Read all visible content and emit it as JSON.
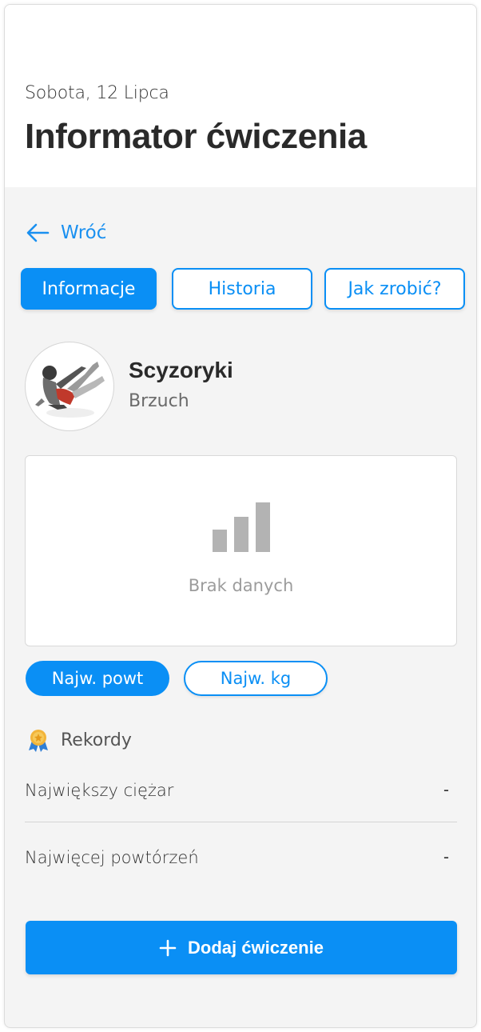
{
  "header": {
    "date": "Sobota, 12 Lipca",
    "title": "Informator ćwiczenia"
  },
  "nav": {
    "back_label": "Wróć"
  },
  "tabs": [
    {
      "label": "Informacje",
      "active": true
    },
    {
      "label": "Historia",
      "active": false
    },
    {
      "label": "Jak zrobić?",
      "active": false
    }
  ],
  "exercise": {
    "name": "Scyzoryki",
    "muscle_group": "Brzuch"
  },
  "chart": {
    "empty_text": "Brak danych"
  },
  "chart_toggle": [
    {
      "label": "Najw. powt",
      "active": true
    },
    {
      "label": "Najw. kg",
      "active": false
    }
  ],
  "records": {
    "title": "Rekordy",
    "rows": [
      {
        "label": "Największy ciężar",
        "value": "-"
      },
      {
        "label": "Najwięcej powtórzeń",
        "value": "-"
      }
    ]
  },
  "actions": {
    "add_label": "Dodaj ćwiczenie"
  },
  "colors": {
    "accent": "#0a8ff5",
    "background": "#f4f4f4",
    "muted_text": "#9c9c9c"
  }
}
